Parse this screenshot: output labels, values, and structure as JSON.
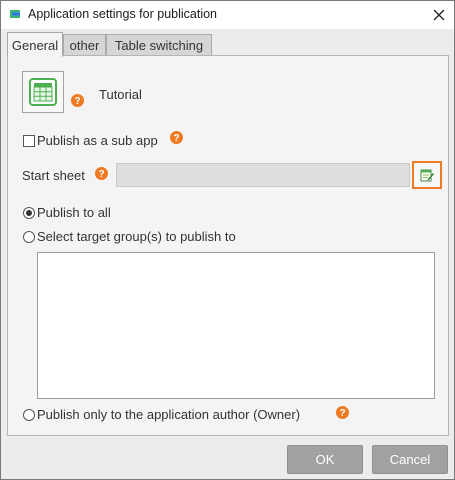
{
  "window": {
    "title": "Application settings for publication"
  },
  "tabs": [
    {
      "label": "General",
      "active": true
    },
    {
      "label": "other",
      "active": false
    },
    {
      "label": "Table switching",
      "active": false
    }
  ],
  "general": {
    "app_name": "Tutorial",
    "publish_sub_app_label": "Publish as a sub app",
    "publish_sub_app_checked": false,
    "start_sheet_label": "Start sheet",
    "start_sheet_value": "",
    "radio_publish_all": "Publish to all",
    "radio_select_groups": "Select target group(s) to publish to",
    "radio_owner_only": "Publish only to the application author (Owner)",
    "selected_option": "publish_all"
  },
  "footer": {
    "ok_label": "OK",
    "cancel_label": "Cancel"
  },
  "icons": {
    "app": "table-sheet-icon",
    "help": "question-mark-icon",
    "edit": "edit-sheet-icon",
    "close": "close-icon"
  },
  "colors": {
    "accent": "#ef7a22",
    "app_icon_green": "#4caf50",
    "button_gray": "#a1a1a1",
    "brand_green": "#3cb371",
    "brand_blue": "#2a7ad8"
  }
}
